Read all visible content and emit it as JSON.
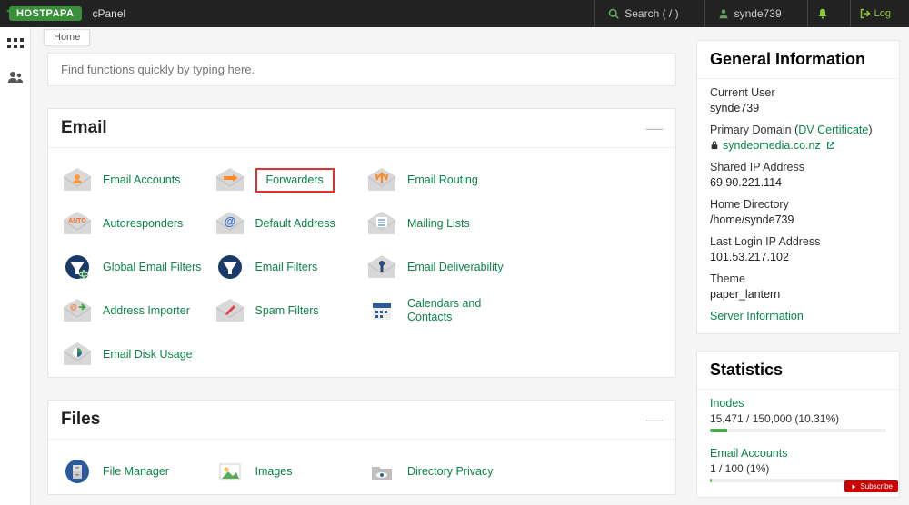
{
  "header": {
    "logo_text": "HOSTPAPA",
    "brand": "cPanel",
    "search_label": "Search ( / )",
    "username": "synde739",
    "logout_label": "Log"
  },
  "breadcrumb": "Home",
  "searchbox": {
    "placeholder": "Find functions quickly by typing here."
  },
  "sections": {
    "email": {
      "title": "Email",
      "items": [
        {
          "label": "Email Accounts",
          "icon": "envelope-user"
        },
        {
          "label": "Forwarders",
          "icon": "envelope-arrow",
          "highlight": true
        },
        {
          "label": "Email Routing",
          "icon": "envelope-route"
        },
        {
          "label": "",
          "icon": ""
        },
        {
          "label": "Autoresponders",
          "icon": "envelope-auto"
        },
        {
          "label": "Default Address",
          "icon": "envelope-at"
        },
        {
          "label": "Mailing Lists",
          "icon": "envelope-list"
        },
        {
          "label": "",
          "icon": ""
        },
        {
          "label": "Global Email Filters",
          "icon": "funnel-globe"
        },
        {
          "label": "Email Filters",
          "icon": "funnel"
        },
        {
          "label": "Email Deliverability",
          "icon": "envelope-key"
        },
        {
          "label": "",
          "icon": ""
        },
        {
          "label": "Address Importer",
          "icon": "envelope-import"
        },
        {
          "label": "Spam Filters",
          "icon": "envelope-edit"
        },
        {
          "label": "Calendars and Contacts",
          "icon": "calendar"
        },
        {
          "label": "",
          "icon": ""
        },
        {
          "label": "Email Disk Usage",
          "icon": "envelope-disk"
        }
      ]
    },
    "files": {
      "title": "Files",
      "items": [
        {
          "label": "File Manager",
          "icon": "filecab"
        },
        {
          "label": "Images",
          "icon": "images"
        },
        {
          "label": "Directory Privacy",
          "icon": "folder-eye"
        }
      ]
    }
  },
  "general": {
    "title": "General Information",
    "current_user_label": "Current User",
    "current_user": "synde739",
    "primary_domain_label": "Primary Domain",
    "dv_cert": "DV Certificate",
    "domain": "syndeomedia.co.nz",
    "shared_ip_label": "Shared IP Address",
    "shared_ip": "69.90.221.114",
    "home_dir_label": "Home Directory",
    "home_dir": "/home/synde739",
    "last_login_label": "Last Login IP Address",
    "last_login": "101.53.217.102",
    "theme_label": "Theme",
    "theme": "paper_lantern",
    "server_info": "Server Information"
  },
  "stats": {
    "title": "Statistics",
    "inodes": {
      "label": "Inodes",
      "text": "15,471 / 150,000   (10.31%)",
      "pct": 10
    },
    "email": {
      "label": "Email Accounts",
      "text": "1 / 100   (1%)",
      "pct": 1
    }
  },
  "subscribe": "Subscribe"
}
